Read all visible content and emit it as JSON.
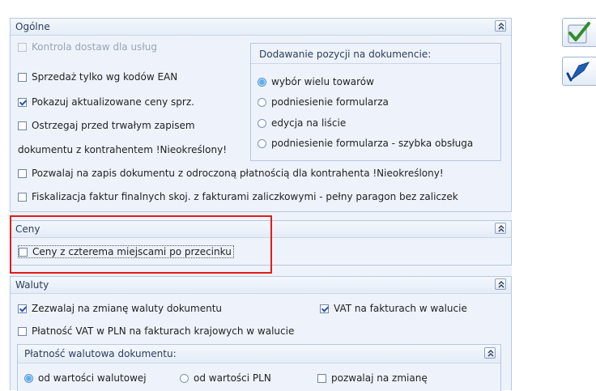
{
  "general": {
    "title": "Ogólne",
    "options": [
      {
        "label": "Kontrola dostaw dla usług",
        "checked": false,
        "disabled": true
      },
      {
        "label": "Sprzedaż tylko wg kodów EAN",
        "checked": false
      },
      {
        "label": "Pokazuj aktualizowane ceny sprz.",
        "checked": true
      },
      {
        "label": "Ostrzegaj przed trwałym zapisem",
        "checked": false
      },
      {
        "label": "dokumentu z kontrahentem !Nieokreślony!"
      }
    ],
    "adding_group": {
      "title": "Dodawanie pozycji na dokumencie:",
      "options": [
        {
          "label": "wybór wielu towarów",
          "selected": true
        },
        {
          "label": "podniesienie formularza",
          "selected": false
        },
        {
          "label": "edycja na liście",
          "selected": false
        },
        {
          "label": "podniesienie formularza - szybka obsługa",
          "selected": false
        }
      ]
    },
    "wide_options": [
      {
        "label": "Pozwalaj na zapis dokumentu z odroczoną płatnością dla kontrahenta !Nieokreślony!",
        "checked": false
      },
      {
        "label": "Fiskalizacja faktur finalnych skoj. z fakturami zaliczkowymi - pełny paragon bez zaliczek",
        "checked": false
      }
    ]
  },
  "prices": {
    "title": "Ceny",
    "options": [
      {
        "label": "Ceny z czterema miejscami po przecinku",
        "checked": false
      }
    ]
  },
  "currencies": {
    "title": "Waluty",
    "options": [
      {
        "label": "Zezwalaj na zmianę waluty dokumentu",
        "checked": true
      },
      {
        "label": "VAT na fakturach w walucie",
        "checked": true
      },
      {
        "label": "Płatność VAT w PLN na fakturach krajowych w walucie",
        "checked": false
      }
    ],
    "payment_group": {
      "title": "Płatność walutowa dokumentu:",
      "options": [
        {
          "label": "od wartości walutowej",
          "selected": true
        },
        {
          "label": "od wartości PLN",
          "selected": false
        }
      ],
      "allow_change": {
        "label": "pozwalaj na zmianę",
        "checked": false
      }
    }
  },
  "toolbar": {
    "buttons": [
      {
        "name": "save-icon",
        "color": "#2f8f2a"
      },
      {
        "name": "undo-icon",
        "color": "#1e5fb4"
      }
    ]
  }
}
